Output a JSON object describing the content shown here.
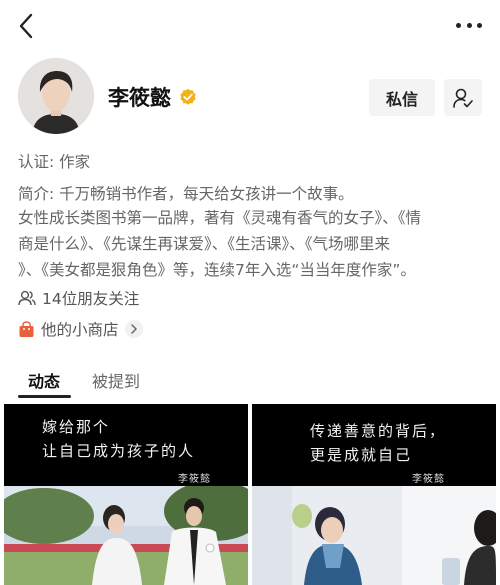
{
  "header": {
    "back_icon": "chevron-left-icon",
    "more_icon": "more-dots-icon"
  },
  "profile": {
    "name": "李筱懿",
    "verified_icon": "verified-badge-icon",
    "verified_color": "#F5B014",
    "message_button": "私信",
    "follow_icon": "user-follow-icon",
    "certification": "认证: 作家",
    "intro_lines": [
      "简介: 千万畅销书作者，每天给女孩讲一个故事。",
      "女性成长类图书第一品牌，著有《灵魂有香气的女子》、《情",
      "商是什么》、《先谋生再谋爱》、《生活课》、《气场哪里来",
      "》、《美女都是狠角色》等，连续7年入选“当当年度作家”。"
    ],
    "friends_following": "14位朋友关注",
    "shop_link": "他的小商店",
    "shop_icon_color": "#E8603C"
  },
  "tabs": [
    {
      "label": "动态",
      "active": true
    },
    {
      "label": "被提到",
      "active": false
    }
  ],
  "posts": [
    {
      "quote_line1": "嫁给那个",
      "quote_line2": "让自己成为孩子的人",
      "signature": "李筱懿"
    },
    {
      "quote_line1": "传递善意的背后，",
      "quote_line2": "更是成就自己",
      "signature": "李筱懿"
    }
  ]
}
